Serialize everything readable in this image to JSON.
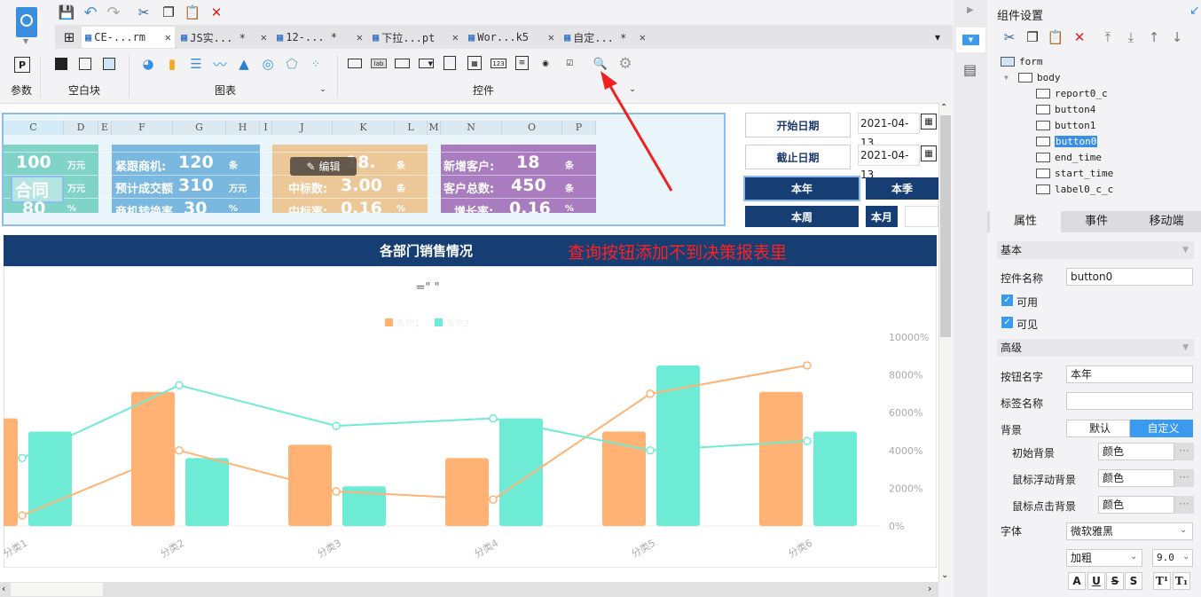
{
  "toolbar": {
    "icons": [
      "save-icon",
      "undo-icon",
      "redo-icon",
      "cut-icon",
      "copy-icon",
      "paste-icon",
      "delete-icon"
    ]
  },
  "tabs": [
    {
      "label": "CE-...rm",
      "active": true
    },
    {
      "label": "JS实... *"
    },
    {
      "label": "12-... *"
    },
    {
      "label": "下拉...pt"
    },
    {
      "label": "Wor...k5"
    },
    {
      "label": "自定... *"
    }
  ],
  "ribbon": {
    "groups": {
      "params": "参数",
      "blank": "空白块",
      "chart": "图表",
      "controls": "控件"
    }
  },
  "sheet": {
    "columns": [
      "C",
      "D",
      "E",
      "F",
      "G",
      "H",
      "I",
      "J",
      "K",
      "L",
      "M",
      "N",
      "O",
      "P"
    ],
    "teal": {
      "v1": "100",
      "u1": "万元",
      "l2": "合同",
      "u2": "万元",
      "v3": "80",
      "u3": "%"
    },
    "blue": {
      "l1": "紧跟商机:",
      "v1": "120",
      "u1": "条",
      "l2": "预计成交额",
      "v2": "310",
      "u2": "万元",
      "l3": "商机转换率",
      "v3": "30",
      "u3": "%"
    },
    "orange": {
      "v1": "18.",
      "u1": "条",
      "l2": "中标数:",
      "v2": "3.00",
      "u2": "条",
      "l3": "中标率:",
      "v3": "0.16",
      "u3": "%"
    },
    "purple": {
      "l1": "新增客户:",
      "v1": "18",
      "u1": "条",
      "l2": "客户总数:",
      "v2": "450",
      "u2": "条",
      "l3": "增长率:",
      "v3": "0.16",
      "u3": "%"
    },
    "edit_tooltip": "编辑"
  },
  "controls": {
    "start_label": "开始日期",
    "end_label": "截止日期",
    "start_date": "2021-04-13",
    "end_date": "2021-04-13",
    "year": "本年",
    "season": "本季",
    "week": "本周",
    "month": "本月"
  },
  "banner": {
    "title": "各部门销售情况",
    "annotation": "查询按钮添加不到决策报表里"
  },
  "chart_data": {
    "type": "bar+line",
    "title": "=\" \"",
    "categories": [
      "分类1",
      "分类2",
      "分类3",
      "分类4",
      "分类5",
      "分类6"
    ],
    "legend": [
      "系列1",
      "系列2"
    ],
    "bar_series": [
      {
        "values": [
          57,
          71,
          43,
          36,
          50,
          71
        ],
        "color": "#ffb273"
      },
      {
        "values": [
          50,
          36,
          21,
          57,
          85,
          50
        ],
        "color": "#6eebd4"
      }
    ],
    "line_series": [
      {
        "values": [
          560,
          4000,
          1830,
          1400,
          7000,
          8500
        ],
        "color": "#ffb273"
      },
      {
        "values": [
          3600,
          7450,
          5300,
          5700,
          4000,
          4500
        ],
        "color": "#6eebd4"
      }
    ],
    "y_right": {
      "ticks": [
        "0%",
        "2000%",
        "4000%",
        "6000%",
        "8000%",
        "10000%"
      ],
      "range": [
        0,
        10000
      ]
    }
  },
  "panel": {
    "title": "组件设置",
    "tree": [
      "form",
      "body",
      "report0_c",
      "button4",
      "button1",
      "button0",
      "end_time",
      "start_time",
      "label0_c_c"
    ],
    "selected": "button0",
    "tabs": [
      "属性",
      "事件",
      "移动端"
    ],
    "basic": "基本",
    "name_label": "控件名称",
    "name_value": "button0",
    "enabled": "可用",
    "visible": "可见",
    "advanced": "高级",
    "btn_name_label": "按钮名字",
    "btn_name_value": "本年",
    "tag_label": "标签名称",
    "tag_value": "",
    "bg_label": "背景",
    "bg_default": "默认",
    "bg_custom": "自定义",
    "init_bg": "初始背景",
    "hover_bg": "鼠标浮动背景",
    "click_bg": "鼠标点击背景",
    "color": "颜色",
    "font_label": "字体",
    "font_value": "微软雅黑",
    "weight_value": "加粗",
    "size_value": "9.0"
  }
}
